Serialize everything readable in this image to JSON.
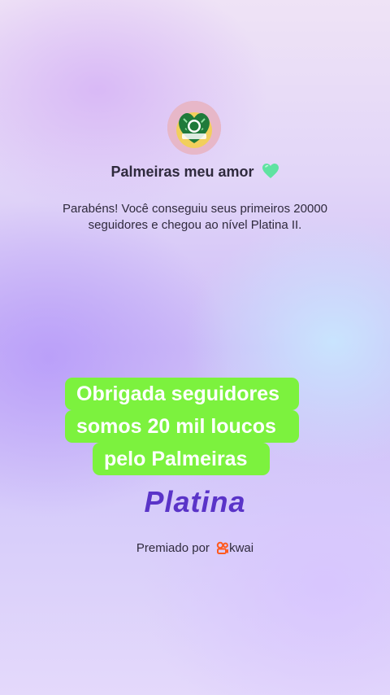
{
  "profile": {
    "name": "Palmeiras meu amor",
    "heart_icon": "green-heart-icon",
    "heart_color": "#5fe3a1"
  },
  "message": "Parabéns! Você conseguiu seus primeiros 20000 seguidores e chegou ao nível Platina II.",
  "overlay_caption": {
    "lines": [
      "Obrigada seguidores",
      "somos 20 mil loucos",
      "pelo Palmeiras"
    ],
    "background_color": "#7cf23e"
  },
  "tier": {
    "label": "Platina",
    "color": "#5a34c8"
  },
  "footer": {
    "awarded_by": "Premiado por",
    "brand": "kwai",
    "brand_color": "#ff5a1f"
  }
}
